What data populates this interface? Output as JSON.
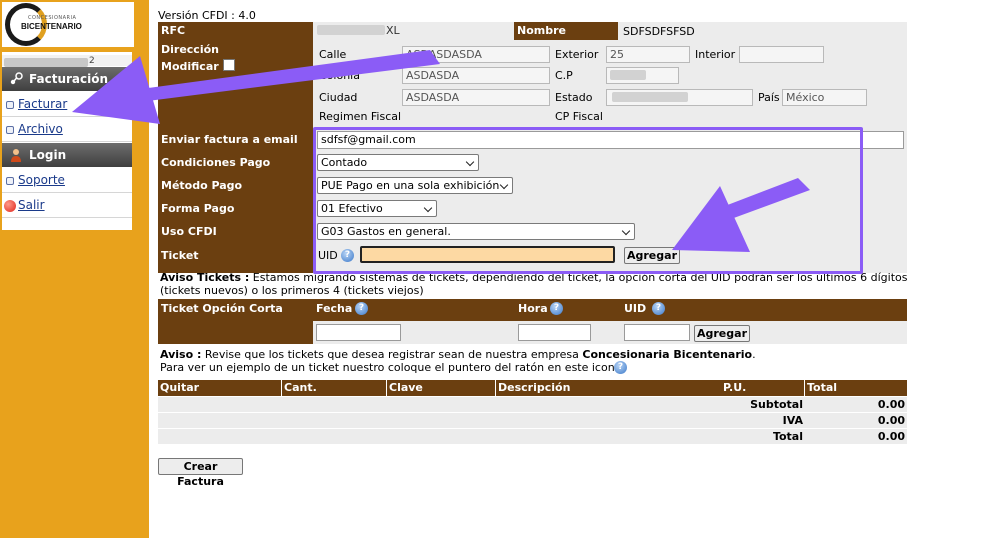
{
  "logo": {
    "small_text": "CONCESIONARIA",
    "big_text": "BICENTENARIO"
  },
  "sidebar": {
    "user_suffix": "2",
    "sections": [
      {
        "header": "Facturación",
        "icon": "steam-icon"
      },
      {
        "header": "Login",
        "icon": "user-icon"
      }
    ],
    "items": {
      "facturar": "Facturar",
      "archivo": "Archivo",
      "soporte": "Soporte",
      "salir": "Salir"
    }
  },
  "header": {
    "version": "Versión CFDI : 4.0"
  },
  "form": {
    "rfc_label": "RFC",
    "rfc_value_suffix": "XL",
    "nombre_label": "Nombre",
    "nombre_value": "SDFSDFSFSD",
    "direccion_label": "Dirección",
    "modificar_label": "Modificar",
    "calle_label": "Calle",
    "calle_value": "ASDASDASDA",
    "exterior_label": "Exterior",
    "exterior_value": "25",
    "interior_label": "Interior",
    "interior_value": "",
    "colonia_label": "Colonia",
    "colonia_value": "ASDASDA",
    "cp_label": "C.P",
    "cp_value": "",
    "ciudad_label": "Ciudad",
    "ciudad_value": "ASDASDA",
    "estado_label": "Estado",
    "estado_value": "",
    "pais_label": "País",
    "pais_value": "México",
    "regimen_label": "Regimen Fiscal",
    "cp_fiscal_label": "CP Fiscal",
    "email_label": "Enviar factura a email",
    "email_value": "sdfsf@gmail.com",
    "condiciones_label": "Condiciones Pago",
    "condiciones_value": "Contado",
    "metodo_label": "Método Pago",
    "metodo_value": "PUE Pago en una sola exhibición",
    "forma_label": "Forma Pago",
    "forma_value": "01 Efectivo",
    "uso_label": "Uso CFDI",
    "uso_value": "G03 Gastos en general.",
    "ticket_label": "Ticket",
    "uid_label": "UID",
    "uid_value": "",
    "agregar_label": "Agregar"
  },
  "aviso_tickets": {
    "title": "Aviso Tickets :",
    "text1": " Estamos migrando sistemas de tickets, dependiendo del ticket, la opción corta del UID podrán ser los últimos 6 dígitos",
    "text2": "(tickets nuevos) o los primeros 4 (tickets viejos)"
  },
  "ticket_corto": {
    "label": "Ticket Opción Corta",
    "fecha_label": "Fecha",
    "hora_label": "Hora",
    "uid_label": "UID",
    "agregar_label": "Agregar"
  },
  "aviso": {
    "title": "Aviso :",
    "text1": " Revise que los tickets que desea registrar sean de nuestra empresa ",
    "company": "Concesionaria Bicentenario",
    "text1_end": ".",
    "text2": "Para ver un ejemplo de un ticket nuestro coloque el puntero del ratón en este icono"
  },
  "table": {
    "headers": [
      "Quitar",
      "Cant.",
      "Clave",
      "Descripción",
      "P.U.",
      "Total"
    ],
    "subtotal_label": "Subtotal",
    "subtotal_value": "0.00",
    "iva_label": "IVA",
    "iva_value": "0.00",
    "total_label": "Total",
    "total_value": "0.00"
  },
  "crear_label": "Crear Factura",
  "colors": {
    "sidebar": "#e8a21c",
    "brown": "#6b3f10",
    "highlight": "#8b5cf6"
  }
}
